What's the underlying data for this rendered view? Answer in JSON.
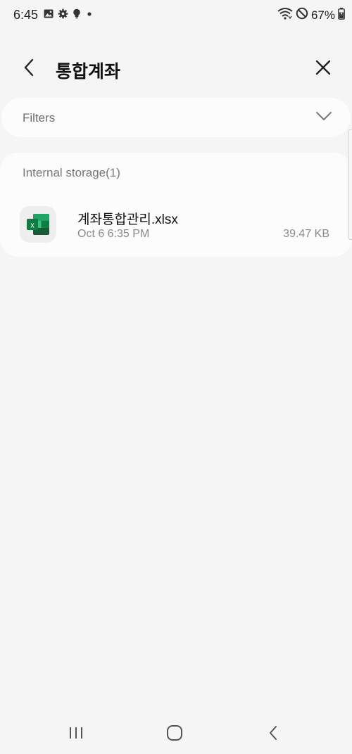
{
  "status_bar": {
    "time": "6:45",
    "battery": "67%",
    "icons": [
      "gallery-icon",
      "settings-icon",
      "lightbulb-icon",
      "dot-icon",
      "wifi-icon",
      "do-not-disturb-icon",
      "battery-icon"
    ]
  },
  "app_bar": {
    "title": "통합계좌",
    "back_icon": "chevron-left-icon",
    "close_icon": "close-icon"
  },
  "filters": {
    "label": "Filters",
    "icon": "chevron-down-icon"
  },
  "storage": {
    "header": "Internal storage(1)",
    "files": [
      {
        "name": "계좌통합관리.xlsx",
        "date": "Oct 6 6:35 PM",
        "size": "39.47 KB",
        "icon": "excel-file-icon"
      }
    ]
  },
  "nav_bar": {
    "items": [
      "recent-apps-icon",
      "home-icon",
      "back-icon"
    ]
  },
  "colors": {
    "background": "#f5f5f5",
    "card": "#fcfcfc",
    "excel_green": "#1e7b45"
  }
}
